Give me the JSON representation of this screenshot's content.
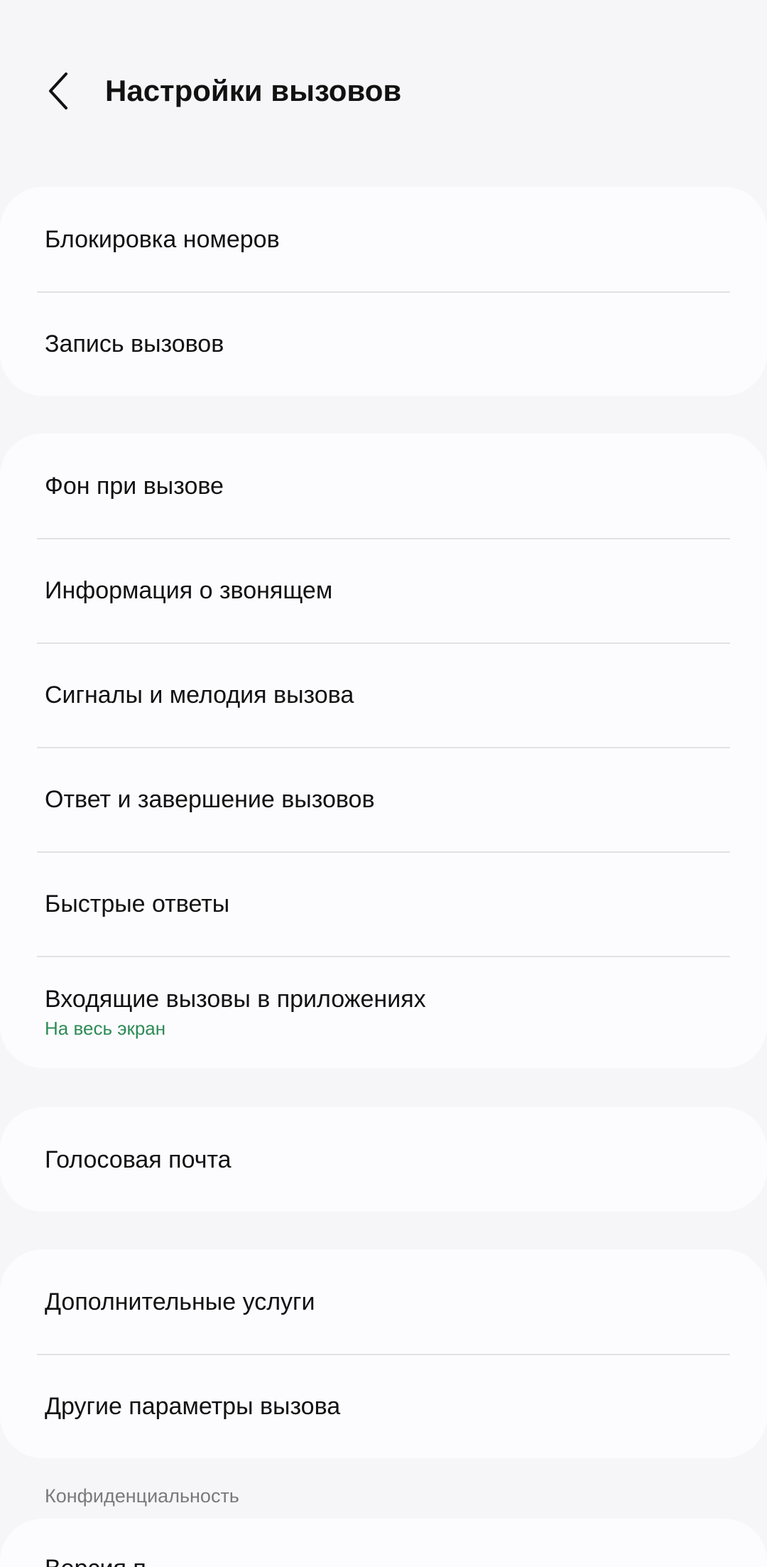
{
  "header": {
    "title": "Настройки вызовов",
    "back_icon": "chevron-left-icon"
  },
  "groups": [
    {
      "items": [
        {
          "label": "Блокировка номеров"
        },
        {
          "label": "Запись вызовов"
        }
      ]
    },
    {
      "items": [
        {
          "label": "Фон при вызове"
        },
        {
          "label": "Информация о звонящем"
        },
        {
          "label": "Сигналы и мелодия вызова"
        },
        {
          "label": "Ответ и завершение вызовов"
        },
        {
          "label": "Быстрые ответы"
        },
        {
          "label": "Входящие вызовы в приложениях",
          "sub": "На весь экран"
        }
      ]
    },
    {
      "items": [
        {
          "label": "Голосовая почта"
        }
      ]
    },
    {
      "items": [
        {
          "label": "Дополнительные услуги"
        },
        {
          "label": "Другие параметры вызова"
        }
      ]
    }
  ],
  "privacy": {
    "section_title": "Конфиденциальность",
    "partial_item_label": "Версия п"
  },
  "colors": {
    "background": "#f6f6f8",
    "card": "#fcfcfe",
    "accent_green": "#2e8b57",
    "divider": "#e2e2e5"
  }
}
